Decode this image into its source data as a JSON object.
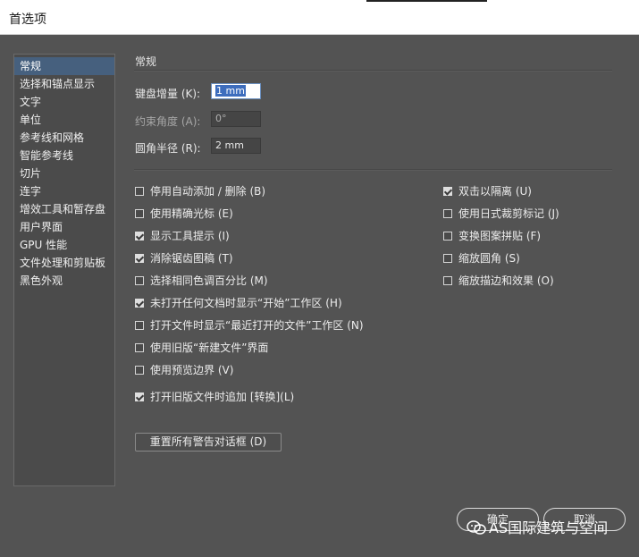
{
  "window": {
    "title": "首选项"
  },
  "sidebar": {
    "items": [
      {
        "label": "常规",
        "selected": true
      },
      {
        "label": "选择和锚点显示"
      },
      {
        "label": "文字"
      },
      {
        "label": "单位"
      },
      {
        "label": "参考线和网格"
      },
      {
        "label": "智能参考线"
      },
      {
        "label": "切片"
      },
      {
        "label": "连字"
      },
      {
        "label": "增效工具和暂存盘"
      },
      {
        "label": "用户界面"
      },
      {
        "label": "GPU 性能"
      },
      {
        "label": "文件处理和剪贴板"
      },
      {
        "label": "黑色外观"
      }
    ]
  },
  "general": {
    "section_title": "常规",
    "fields": [
      {
        "label": "键盘增量 (K):",
        "value": "1 mm",
        "active": true
      },
      {
        "label": "约束角度 (A):",
        "value": "0°",
        "dim": true
      },
      {
        "label": "圆角半径 (R):",
        "value": "2 mm"
      }
    ],
    "left_options": [
      {
        "label": "停用自动添加 / 删除 (B)",
        "checked": false
      },
      {
        "label": "使用精确光标 (E)",
        "checked": false
      },
      {
        "label": "显示工具提示 (I)",
        "checked": true
      },
      {
        "label": "消除锯齿图稿 (T)",
        "checked": true
      },
      {
        "label": "选择相同色调百分比 (M)",
        "checked": false
      },
      {
        "label": "未打开任何文档时显示“开始”工作区 (H)",
        "checked": true
      },
      {
        "label": "打开文件时显示“最近打开的文件”工作区 (N)",
        "checked": false
      },
      {
        "label": "使用旧版“新建文件”界面",
        "checked": false
      },
      {
        "label": "使用预览边界 (V)",
        "checked": false
      },
      {
        "label": "打开旧版文件时追加 [转换](L)",
        "checked": true
      }
    ],
    "right_options": [
      {
        "label": "双击以隔离 (U)",
        "checked": true
      },
      {
        "label": "使用日式裁剪标记 (J)",
        "checked": false
      },
      {
        "label": "变换图案拼贴 (F)",
        "checked": false
      },
      {
        "label": "缩放圆角 (S)",
        "checked": false
      },
      {
        "label": "缩放描边和效果 (O)",
        "checked": false
      }
    ],
    "reset_label": "重置所有警告对话框 (D)"
  },
  "footer": {
    "ok_label": "确定",
    "cancel_label": "取消",
    "watermark": "AS国际建筑与空间"
  },
  "colors": {
    "background": "#535353",
    "selection": "#46607e",
    "input_highlight": "#3d6dbd"
  }
}
